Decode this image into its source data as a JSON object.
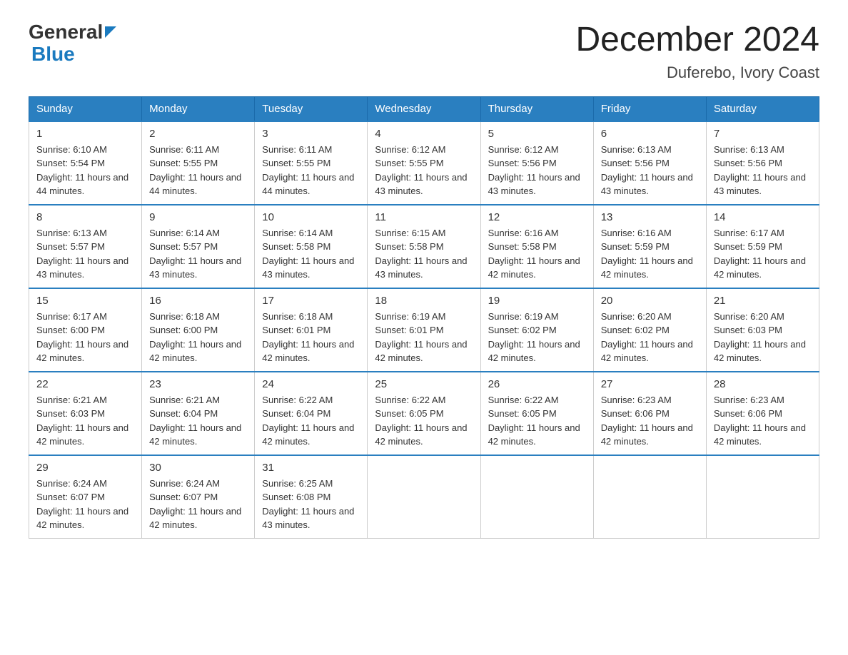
{
  "header": {
    "logo_general": "General",
    "logo_blue": "Blue",
    "month_title": "December 2024",
    "location": "Duferebo, Ivory Coast"
  },
  "days_of_week": [
    "Sunday",
    "Monday",
    "Tuesday",
    "Wednesday",
    "Thursday",
    "Friday",
    "Saturday"
  ],
  "weeks": [
    [
      {
        "day": "1",
        "sunrise": "6:10 AM",
        "sunset": "5:54 PM",
        "daylight": "11 hours and 44 minutes."
      },
      {
        "day": "2",
        "sunrise": "6:11 AM",
        "sunset": "5:55 PM",
        "daylight": "11 hours and 44 minutes."
      },
      {
        "day": "3",
        "sunrise": "6:11 AM",
        "sunset": "5:55 PM",
        "daylight": "11 hours and 44 minutes."
      },
      {
        "day": "4",
        "sunrise": "6:12 AM",
        "sunset": "5:55 PM",
        "daylight": "11 hours and 43 minutes."
      },
      {
        "day": "5",
        "sunrise": "6:12 AM",
        "sunset": "5:56 PM",
        "daylight": "11 hours and 43 minutes."
      },
      {
        "day": "6",
        "sunrise": "6:13 AM",
        "sunset": "5:56 PM",
        "daylight": "11 hours and 43 minutes."
      },
      {
        "day": "7",
        "sunrise": "6:13 AM",
        "sunset": "5:56 PM",
        "daylight": "11 hours and 43 minutes."
      }
    ],
    [
      {
        "day": "8",
        "sunrise": "6:13 AM",
        "sunset": "5:57 PM",
        "daylight": "11 hours and 43 minutes."
      },
      {
        "day": "9",
        "sunrise": "6:14 AM",
        "sunset": "5:57 PM",
        "daylight": "11 hours and 43 minutes."
      },
      {
        "day": "10",
        "sunrise": "6:14 AM",
        "sunset": "5:58 PM",
        "daylight": "11 hours and 43 minutes."
      },
      {
        "day": "11",
        "sunrise": "6:15 AM",
        "sunset": "5:58 PM",
        "daylight": "11 hours and 43 minutes."
      },
      {
        "day": "12",
        "sunrise": "6:16 AM",
        "sunset": "5:58 PM",
        "daylight": "11 hours and 42 minutes."
      },
      {
        "day": "13",
        "sunrise": "6:16 AM",
        "sunset": "5:59 PM",
        "daylight": "11 hours and 42 minutes."
      },
      {
        "day": "14",
        "sunrise": "6:17 AM",
        "sunset": "5:59 PM",
        "daylight": "11 hours and 42 minutes."
      }
    ],
    [
      {
        "day": "15",
        "sunrise": "6:17 AM",
        "sunset": "6:00 PM",
        "daylight": "11 hours and 42 minutes."
      },
      {
        "day": "16",
        "sunrise": "6:18 AM",
        "sunset": "6:00 PM",
        "daylight": "11 hours and 42 minutes."
      },
      {
        "day": "17",
        "sunrise": "6:18 AM",
        "sunset": "6:01 PM",
        "daylight": "11 hours and 42 minutes."
      },
      {
        "day": "18",
        "sunrise": "6:19 AM",
        "sunset": "6:01 PM",
        "daylight": "11 hours and 42 minutes."
      },
      {
        "day": "19",
        "sunrise": "6:19 AM",
        "sunset": "6:02 PM",
        "daylight": "11 hours and 42 minutes."
      },
      {
        "day": "20",
        "sunrise": "6:20 AM",
        "sunset": "6:02 PM",
        "daylight": "11 hours and 42 minutes."
      },
      {
        "day": "21",
        "sunrise": "6:20 AM",
        "sunset": "6:03 PM",
        "daylight": "11 hours and 42 minutes."
      }
    ],
    [
      {
        "day": "22",
        "sunrise": "6:21 AM",
        "sunset": "6:03 PM",
        "daylight": "11 hours and 42 minutes."
      },
      {
        "day": "23",
        "sunrise": "6:21 AM",
        "sunset": "6:04 PM",
        "daylight": "11 hours and 42 minutes."
      },
      {
        "day": "24",
        "sunrise": "6:22 AM",
        "sunset": "6:04 PM",
        "daylight": "11 hours and 42 minutes."
      },
      {
        "day": "25",
        "sunrise": "6:22 AM",
        "sunset": "6:05 PM",
        "daylight": "11 hours and 42 minutes."
      },
      {
        "day": "26",
        "sunrise": "6:22 AM",
        "sunset": "6:05 PM",
        "daylight": "11 hours and 42 minutes."
      },
      {
        "day": "27",
        "sunrise": "6:23 AM",
        "sunset": "6:06 PM",
        "daylight": "11 hours and 42 minutes."
      },
      {
        "day": "28",
        "sunrise": "6:23 AM",
        "sunset": "6:06 PM",
        "daylight": "11 hours and 42 minutes."
      }
    ],
    [
      {
        "day": "29",
        "sunrise": "6:24 AM",
        "sunset": "6:07 PM",
        "daylight": "11 hours and 42 minutes."
      },
      {
        "day": "30",
        "sunrise": "6:24 AM",
        "sunset": "6:07 PM",
        "daylight": "11 hours and 42 minutes."
      },
      {
        "day": "31",
        "sunrise": "6:25 AM",
        "sunset": "6:08 PM",
        "daylight": "11 hours and 43 minutes."
      },
      null,
      null,
      null,
      null
    ]
  ]
}
